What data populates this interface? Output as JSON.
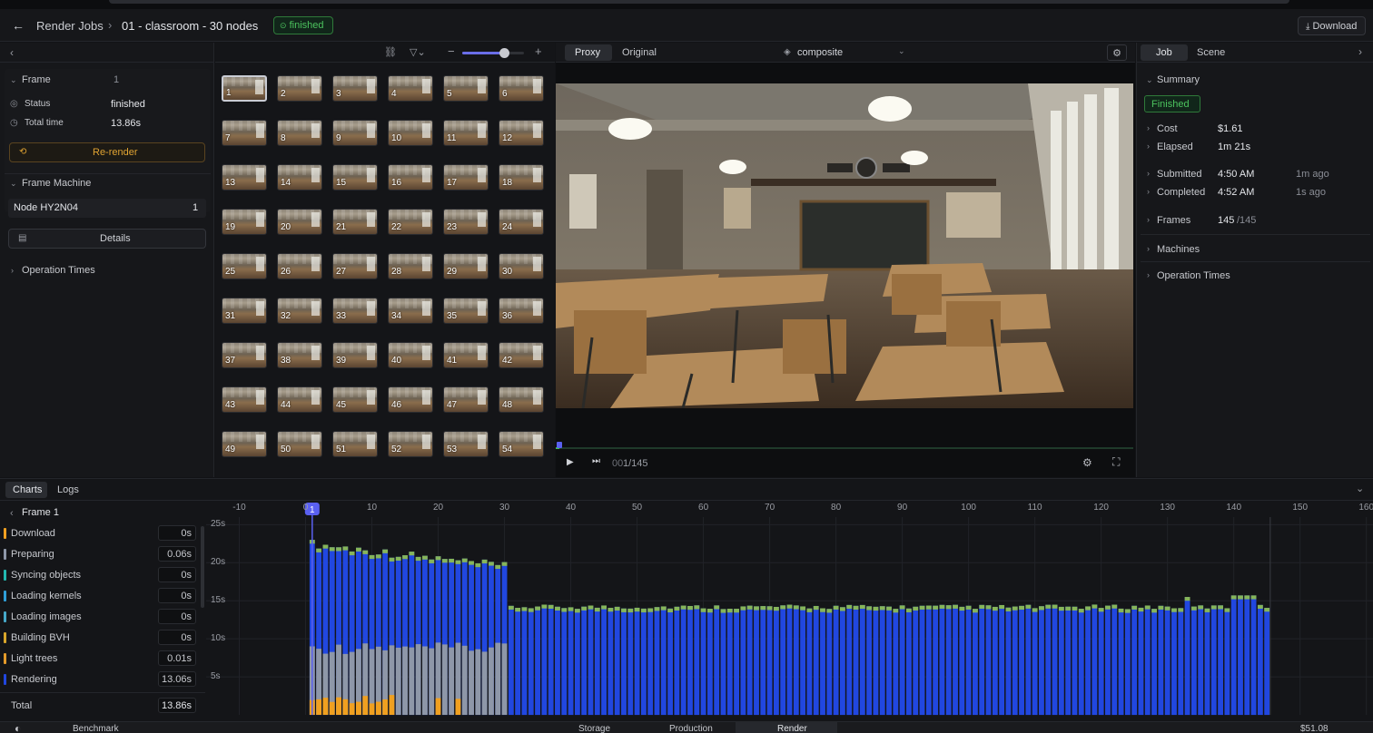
{
  "header": {
    "back_icon": "arrow-left-icon",
    "breadcrumb_root": "Render Jobs",
    "breadcrumb_sep": "›",
    "job_title": "01 - classroom - 30 nodes",
    "status_badge": "finished",
    "download_label": "Download",
    "status_color": "#3fb950"
  },
  "frame_panel": {
    "title": "Frame",
    "frame_number": "1",
    "status_label": "Status",
    "status_value": "finished",
    "total_time_label": "Total time",
    "total_time_value": "13.86s",
    "rerender_label": "Re-render",
    "machine_title": "Frame Machine",
    "node_name": "Node HY2N04",
    "node_count": "1",
    "details_label": "Details",
    "operation_times_label": "Operation Times"
  },
  "grid": {
    "zoom_level": 0.68,
    "frames": [
      "1",
      "2",
      "3",
      "4",
      "5",
      "6",
      "7",
      "8",
      "9",
      "10",
      "11",
      "12",
      "13",
      "14",
      "15",
      "16",
      "17",
      "18",
      "19",
      "20",
      "21",
      "22",
      "23",
      "24",
      "25",
      "26",
      "27",
      "28",
      "29",
      "30",
      "31",
      "32",
      "33",
      "34",
      "35",
      "36",
      "37",
      "38",
      "39",
      "40",
      "41",
      "42",
      "43",
      "44",
      "45",
      "46",
      "47",
      "48",
      "49",
      "50",
      "51",
      "52",
      "53",
      "54"
    ],
    "selected": "1"
  },
  "viewer": {
    "tab_proxy": "Proxy",
    "tab_original": "Original",
    "layer_select": "composite",
    "frame_counter_prefix": "00",
    "frame_counter": "1/145",
    "progress": 0.007
  },
  "job_panel": {
    "tab_job": "Job",
    "tab_scene": "Scene",
    "summary_title": "Summary",
    "status_badge": "Finished",
    "cost_label": "Cost",
    "cost_value": "$1.61",
    "elapsed_label": "Elapsed",
    "elapsed_value": "1m 21s",
    "submitted_label": "Submitted",
    "submitted_value": "4:50 AM",
    "submitted_ago": "1m ago",
    "completed_label": "Completed",
    "completed_value": "4:52 AM",
    "completed_ago": "1s ago",
    "frames_label": "Frames",
    "frames_done": "145",
    "frames_total": "/145",
    "machines_label": "Machines",
    "operation_times_label": "Operation Times"
  },
  "bottom": {
    "tab_charts": "Charts",
    "tab_logs": "Logs",
    "frame_label": "Frame 1",
    "stages": [
      {
        "name": "Download",
        "value": "0s",
        "color": "#f0a020"
      },
      {
        "name": "Preparing",
        "value": "0.06s",
        "color": "#8e97a8"
      },
      {
        "name": "Syncing objects",
        "value": "0s",
        "color": "#22b8b0"
      },
      {
        "name": "Loading kernels",
        "value": "0s",
        "color": "#2f9fd8"
      },
      {
        "name": "Loading images",
        "value": "0s",
        "color": "#46a8c8"
      },
      {
        "name": "Building BVH",
        "value": "0s",
        "color": "#d9a62b"
      },
      {
        "name": "Light trees",
        "value": "0s",
        "color": "#e39a2a"
      },
      {
        "name": "Rendering",
        "value": "13.06s",
        "color": "#2147e0"
      }
    ],
    "stage_values_override": {
      "Light trees": "0.01s"
    },
    "total_label": "Total",
    "total_value": "13.86s"
  },
  "chart_data": {
    "type": "bar",
    "x_ticks": [
      "-10",
      "0",
      "10",
      "20",
      "30",
      "40",
      "50",
      "60",
      "70",
      "80",
      "90",
      "100",
      "110",
      "120",
      "130",
      "140",
      "150",
      "160"
    ],
    "y_ticks": [
      "25s",
      "20s",
      "15s",
      "10s",
      "5s"
    ],
    "xlim": [
      -15,
      161
    ],
    "ylim": [
      0,
      26
    ],
    "cursor_label": "1",
    "stacked_series_colors": {
      "render": "#2147e0",
      "top": "#86b55a",
      "prep": "#8e97a8",
      "download": "#f0a020"
    },
    "segments": [
      {
        "from": 1,
        "to": 30,
        "total_start": 22.5,
        "total_end": 19.5,
        "prep": 8,
        "download": 1.5
      },
      {
        "from": 31,
        "to": 145,
        "total": 14.2
      }
    ]
  },
  "footer": {
    "workspace": "Benchmark",
    "tab_storage": "Storage",
    "tab_production": "Production",
    "tab_render": "Render",
    "balance": "$51.08"
  }
}
